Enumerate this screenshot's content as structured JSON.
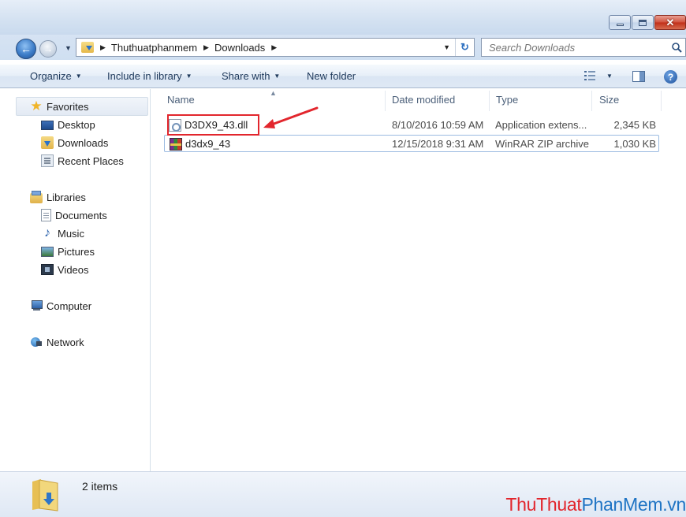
{
  "window": {
    "buttons": [
      "minimize",
      "maximize",
      "close"
    ]
  },
  "nav": {
    "breadcrumb": [
      "Thuthuatphanmem",
      "Downloads"
    ],
    "search_placeholder": "Search Downloads"
  },
  "toolbar": {
    "organize": "Organize",
    "include_in_library": "Include in library",
    "share_with": "Share with",
    "new_folder": "New folder"
  },
  "sidebar": {
    "favorites": {
      "label": "Favorites",
      "items": [
        {
          "label": "Desktop",
          "icon": "desktop-icon"
        },
        {
          "label": "Downloads",
          "icon": "downloads-folder-icon"
        },
        {
          "label": "Recent Places",
          "icon": "recent-places-icon"
        }
      ]
    },
    "libraries": {
      "label": "Libraries",
      "items": [
        {
          "label": "Documents",
          "icon": "documents-icon"
        },
        {
          "label": "Music",
          "icon": "music-icon"
        },
        {
          "label": "Pictures",
          "icon": "pictures-icon"
        },
        {
          "label": "Videos",
          "icon": "videos-icon"
        }
      ]
    },
    "computer": "Computer",
    "network": "Network"
  },
  "filelist": {
    "columns": [
      "Name",
      "Date modified",
      "Type",
      "Size"
    ],
    "rows": [
      {
        "name": "D3DX9_43.dll",
        "date": "8/10/2016 10:59 AM",
        "type": "Application extens...",
        "size": "2,345 KB",
        "icon": "dll-file-icon"
      },
      {
        "name": "d3dx9_43",
        "date": "12/15/2018 9:31 AM",
        "type": "WinRAR ZIP archive",
        "size": "1,030 KB",
        "icon": "winrar-archive-icon"
      }
    ]
  },
  "status": {
    "item_count": "2 items"
  },
  "watermark": {
    "part1": "ThuThuat",
    "part2": "PhanMem",
    "part3": ".vn"
  },
  "colors": {
    "annotation": "#e2262d",
    "watermark_red": "#e2262d",
    "watermark_blue": "#1f74c4"
  }
}
